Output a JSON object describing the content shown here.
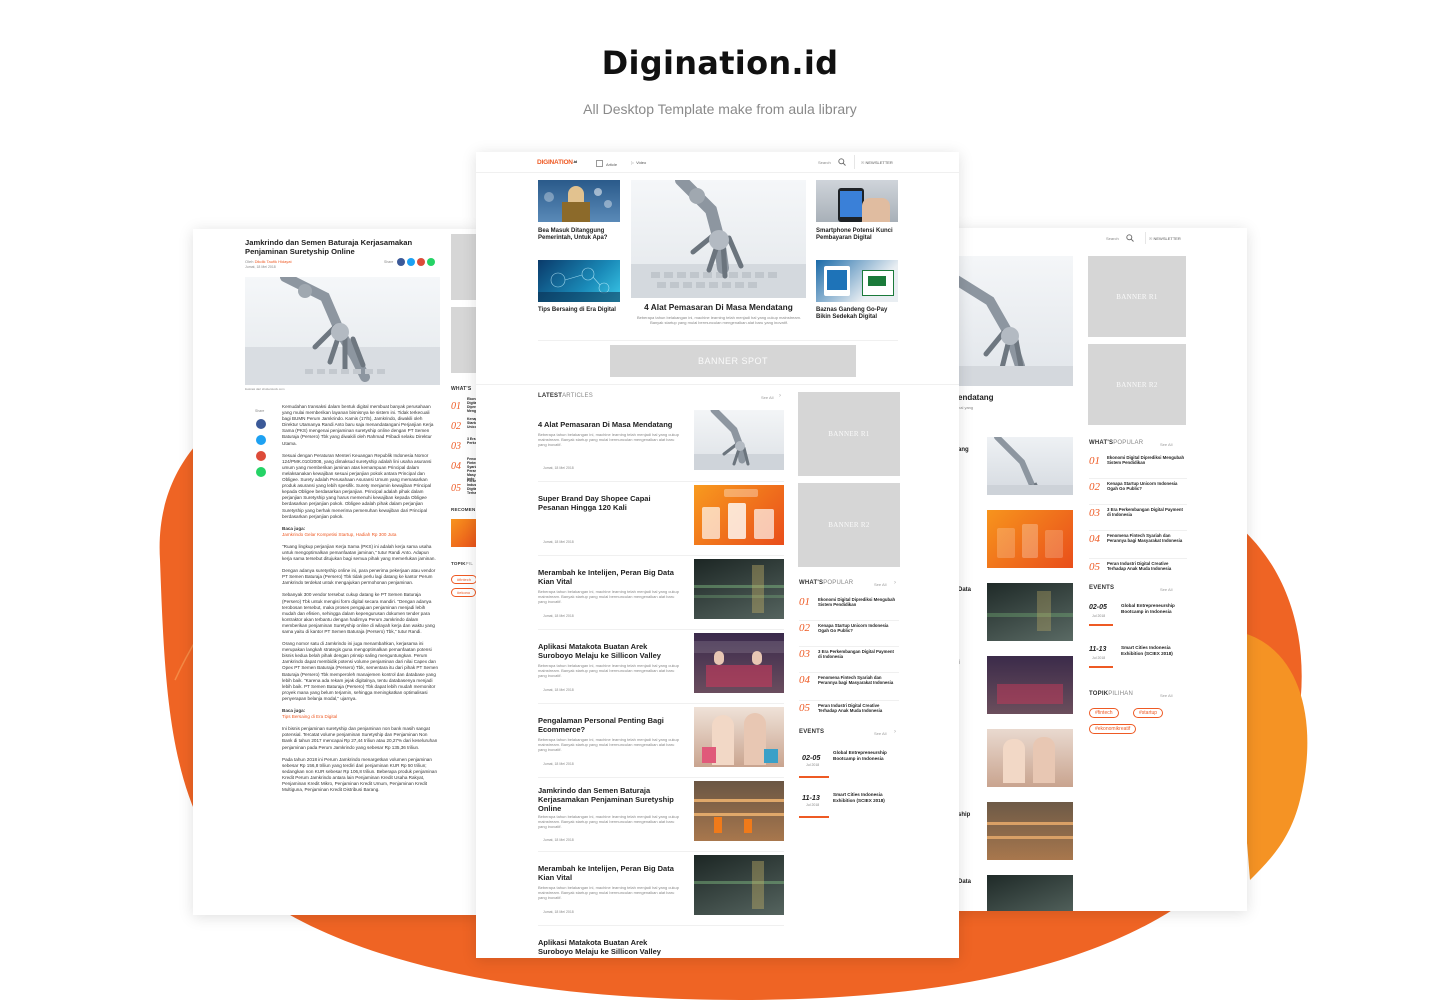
{
  "header": {
    "title": "Digination.id",
    "subtitle": "All Desktop Template make from aula library"
  },
  "colors": {
    "accent": "#ee5a24",
    "blob": "#ef6424",
    "placeholder": "#d6d6d6"
  },
  "center": {
    "nav": {
      "logo_a": "DIGINATION",
      "logo_b": ".id",
      "article": "Article",
      "video": "Video",
      "search": "Search",
      "newsletter": "NEWSLETTER"
    },
    "hero": {
      "left_top_title": "Bea Masuk Ditanggung Pemerintah, Untuk Apa?",
      "left_bottom_title": "Tips Bersaing di Era Digital",
      "main_title": "4 Alat Pemasaran Di Masa Mendatang",
      "main_desc": "Beberapa tahun belakangan ini, machine learning telah menjadi hal yang cukup mainstream. Banyak startup yang mulai bermunculan mengenalkan alat baru yang inovatif.",
      "right_top_title": "Smartphone Potensi Kunci Pembayaran Digital",
      "right_bottom_title": "Baznas Gandeng Go-Pay Bikin Sedekah Digital"
    },
    "banner_spot": "BANNER SPOT",
    "latest": {
      "heading": "LATEST",
      "heading_light": "ARTICLES",
      "see_all": "See All",
      "items": [
        {
          "title": "4 Alat Pemasaran Di Masa Mendatang",
          "desc": "Beberapa tahun belakangan ini, machine learning telah menjadi hal yang cukup mainstream. Banyak startup yang mulai bermunculan mengenalkan alat baru yang inovatif.",
          "date": "Jumat, 18 Mei 2018"
        },
        {
          "title": "Super Brand Day Shopee Capai Pesanan Hingga 120 Kali",
          "desc": "",
          "date": "Jumat, 18 Mei 2018"
        },
        {
          "title": "Merambah ke Intelijen, Peran Big Data Kian Vital",
          "desc": "Beberapa tahun belakangan ini, machine learning telah menjadi hal yang cukup mainstream. Banyak startup yang mulai bermunculan mengenalkan alat baru yang inovatif.",
          "date": "Jumat, 18 Mei 2018"
        },
        {
          "title": "Aplikasi Matakota Buatan Arek Suroboyo Melaju ke Sillicon Valley",
          "desc": "Beberapa tahun belakangan ini, machine learning telah menjadi hal yang cukup mainstream. Banyak startup yang mulai bermunculan mengenalkan alat baru yang inovatif.",
          "date": "Jumat, 18 Mei 2018"
        },
        {
          "title": "Pengalaman Personal Penting Bagi Ecommerce?",
          "desc": "Beberapa tahun belakangan ini, machine learning telah menjadi hal yang cukup mainstream. Banyak startup yang mulai bermunculan mengenalkan alat baru yang inovatif.",
          "date": "Jumat, 18 Mei 2018"
        },
        {
          "title": "Jamkrindo dan Semen Baturaja Kerjasamakan Penjaminan Suretyship Online",
          "desc": "Beberapa tahun belakangan ini, machine learning telah menjadi hal yang cukup mainstream. Banyak startup yang mulai bermunculan mengenalkan alat baru yang inovatif.",
          "date": "Jumat, 18 Mei 2018"
        },
        {
          "title": "Merambah ke Intelijen, Peran Big Data Kian Vital",
          "desc": "Beberapa tahun belakangan ini, machine learning telah menjadi hal yang cukup mainstream. Banyak startup yang mulai bermunculan mengenalkan alat baru yang inovatif.",
          "date": "Jumat, 18 Mei 2018"
        },
        {
          "title": "Aplikasi Matakota Buatan Arek Suroboyo Melaju ke Sillicon Valley",
          "desc": "",
          "date": ""
        }
      ]
    },
    "banner_r1": "BANNER R1",
    "banner_r2": "BANNER R2",
    "popular": {
      "heading": "WHAT'S",
      "heading_light": "POPULAR",
      "see_all": "See All",
      "items": [
        {
          "num": "01",
          "title": "Ekonomi Digital Diprediksi Mengubah Sistem Pendidikan"
        },
        {
          "num": "02",
          "title": "Kenapa Startup Unicorn Indonesia Ogah Go Public?"
        },
        {
          "num": "03",
          "title": "3 Era Perkembangan Digital Payment di Indonesia"
        },
        {
          "num": "04",
          "title": "Fenomena Fintech Syariah dan Perannya bagi Masyarakat Indonesia"
        },
        {
          "num": "05",
          "title": "Peran Industri Digital Creative Terhadap Anak Muda Indonesia"
        }
      ]
    },
    "events": {
      "heading": "EVENTS",
      "see_all": "See All",
      "items": [
        {
          "date": "02-05",
          "month": "Jul 2018",
          "title": "Global Entrepreneurship Bootcamp in Indonesia"
        },
        {
          "date": "11-13",
          "month": "Jul 2018",
          "title": "Smart Cities Indonesia Exhibition (SCIEX 2018)"
        }
      ]
    }
  },
  "left": {
    "title": "Jamkrindo dan Semen Baturaja Kerjasamakan Penjaminan Suretyship Online",
    "by": "Oleh",
    "author": "Dikdik Taufik Hidayat",
    "date": "Jumat, 18 Mei 2018",
    "share": "Share",
    "caption": "ilustrasi dari shutterstock.com",
    "paragraphs": [
      "Kemudahan transaksi dalam bentuk digital membuat banyak perusahaan yang mulai memberikan layanan bisnisnya ke sistem ini. Tidak terkecuali bagi BUMN Perum Jamkrindo. Kamis (17/5), Jamkrindo, diwakili oleh Direktur Utamanya Randi Anto baru saja menandatangani Perjanjian Kerja Sama (PKS) mengenai penjaminan suretyship online dengan PT Semen Baturaja (Persero) Tbk yang diwakili oleh Rahmad Pribadi selaku Direktur Utama.",
      "Sesuai dengan Peraturan Menteri Keuangan Republik Indonesia Nomor 124/PMK.010/2008, yang dimaksud suretyship adalah lini usaha asuransi umum yang memberikan jaminan atas kemampuan Principal dalam melaksanakan kewajiban sesuai perjanjian pokok antara Principal dan Obligee. Surety adalah Perusahaan Asuransi Umum yang memasarkan produk asuransi yang lebih spesifik. Surety menjamin kewajiban Principal kepada Obligee berdasarkan perjanjian. Principal adalah pihak dalam perjanjian Suretyship yang harus memenuhi kewajiban kepada Obligee berdasarkan perjanjian pokok. Obligee adalah pihak dalam perjanjian Suretyship yang berhak menerima pemenuhan kewajiban dari Principal berdasarkan perjanjian pokok."
    ],
    "read_also_1": "Baca juga:",
    "read_also_link_1": "Jamkrindo Gelar Kompetisi Startup, Hadiah Rp 300 Juta",
    "paragraphs2": [
      "\"Ruang lingkup perjanjian Kerja Sama (PKS) ini adalah kerja sama usaha untuk mengoptimalkan pemanfaatan jaminan,\" tutur Randi Anto. Adapun kerja sama tersebut ditujukan bagi semua pihak yang memerlukan jaminan.",
      "Dengan adanya suretyship online ini, para penerima pekerjaan atau vendor PT Semen Baturaja (Persero) Tbk tidak perlu lagi datang ke kantor Perum Jamkrindo terdekat untuk mengajukan permohonan penjaminan.",
      "Sebanyak 300 vendor tersebut cukup datang ke PT Semen Baturaja (Persero) Tbk untuk mengisi form digital secara mandiri. \"Dengan adanya terobosan tersebut, maka proses pengajuan penjaminan menjadi lebih mudah dan efisien, sehingga dalam kepengurusan dokumen tender para kontraktor akan terbantu dengan hadirnya Perum Jamkrindo dalam memberikan penjaminan Suretyship online di wilayah kerja dan waktu yang sama yaitu di kantor PT Semen Baturaja (Persero) Tbk,\" tutur Randi.",
      "Orang nomor satu di Jamkrindo ini juga menambahkan, kerjasama ini merupakan langkah strategis guna mengoptimalkan pemanfaatan potensi bisnis kedua belah pihak dengan prinsip saling menguntungkan. Perum Jamkrindo dapat membidik potensi volume penjaminan dari nilai Capex dan Opex PT Semen Baturaja (Persero) Tbk, sementara itu dari pihak PT Semen Baturaja (Persero) Tbk memperoleh manajemen kontrol dan database yang lebih baik. \"Karena ada rekam jejak digitalnya, tentu databasenya menjadi lebih baik. PT Semen Baturaja (Persero) Tbk dapat lebih mudah memonitor proyek mana yang belum terjamin, sehingga meningkatkan optimalisasi penyerapan belanja modal,\" ujarnya."
    ],
    "read_also_2": "Baca juga:",
    "read_also_link_2": "Tips Bersaing di Era Digital",
    "paragraphs3": [
      "Ini bisnis penjaminan suretyship dan penjaminan non bank masih sangat potensial. Tercatat volume penjaminan Suretyship dan Penjaminan Non Bank di tahun 2017 mencapai Rp 27,44 triliun atau 20,27% dari keseluruhan penjaminan pada Perum Jamkrindo yang sebesar Rp 135,36 triliun.",
      "Pada tahun 2018 ini Perum Jamkrindo menargetkan volumen penjaminan sebesar Rp 156,8 triliun yang terdiri dari penjaminan KUR Rp 50 triliun; sedangkan non KUR sebesar Rp 106,8 triliun. Beberapa produk penjaminan Kredit Perum Jamkrindo antara lain Penjaminan Kredit Usaha Rakyat, Penjaminan Kredit Mikro, Penjaminan Kredit Umum, Penjaminan Kredit Multiguna, Penjaminan Kredit Distribusi Barang."
    ],
    "popular_heading": "WHAT'S",
    "recommend_heading": "RECOMEN",
    "topik_heading": "TOPIK",
    "topik_light": "PIL",
    "tag1": "#fintech",
    "tag2": "#ekono",
    "pop_titles": [
      "Ekonomi Digital Diprediksi Mengubah",
      "Kenapa Startup Unicorn",
      "3 Era Perkembangan",
      "Fenomena Fintech Syariah Peran bagi Masyarakat Indo",
      "Peran Industri Digital Terha"
    ]
  },
  "right": {
    "search": "Search",
    "newsletter": "NEWSLETTER",
    "hero_title_partial": "endatang",
    "hero_desc_partial": "hal yang",
    "list_partial": [
      "ang",
      "Data",
      "i",
      "",
      "ship",
      "Data"
    ],
    "banner_r1": "BANNER R1",
    "banner_r2": "BANNER R2",
    "popular": {
      "heading": "WHAT'S",
      "heading_light": "POPULAR",
      "see_all": "See All",
      "items": [
        {
          "num": "01",
          "title": "Ekonomi Digital Diprediksi Mengubah Sistem Pendidikan"
        },
        {
          "num": "02",
          "title": "Kenapa Startup Unicorn Indonesia Ogah Go Public?"
        },
        {
          "num": "03",
          "title": "3 Era Perkembangan Digital Payment di Indonesia"
        },
        {
          "num": "04",
          "title": "Fenomena Fintech Syariah dan Perannya bagi Masyarakat Indonesia"
        },
        {
          "num": "05",
          "title": "Peran Industri Digital Creative Terhadap Anak Muda Indonesia"
        }
      ]
    },
    "events": {
      "heading": "EVENTS",
      "see_all": "See All",
      "items": [
        {
          "date": "02-05",
          "month": "Jul 2018",
          "title": "Global Entrepreneurship Bootcamp in Indonesia"
        },
        {
          "date": "11-13",
          "month": "Jul 2018",
          "title": "Smart Cities Indonesia Exhibition (SCIEX 2018)"
        }
      ]
    },
    "topik": {
      "heading": "TOPIK",
      "heading_light": "PILIHAN",
      "see_all": "See All",
      "tags": [
        "#fintech",
        "#startup",
        "#ekonomikreatif"
      ]
    }
  }
}
